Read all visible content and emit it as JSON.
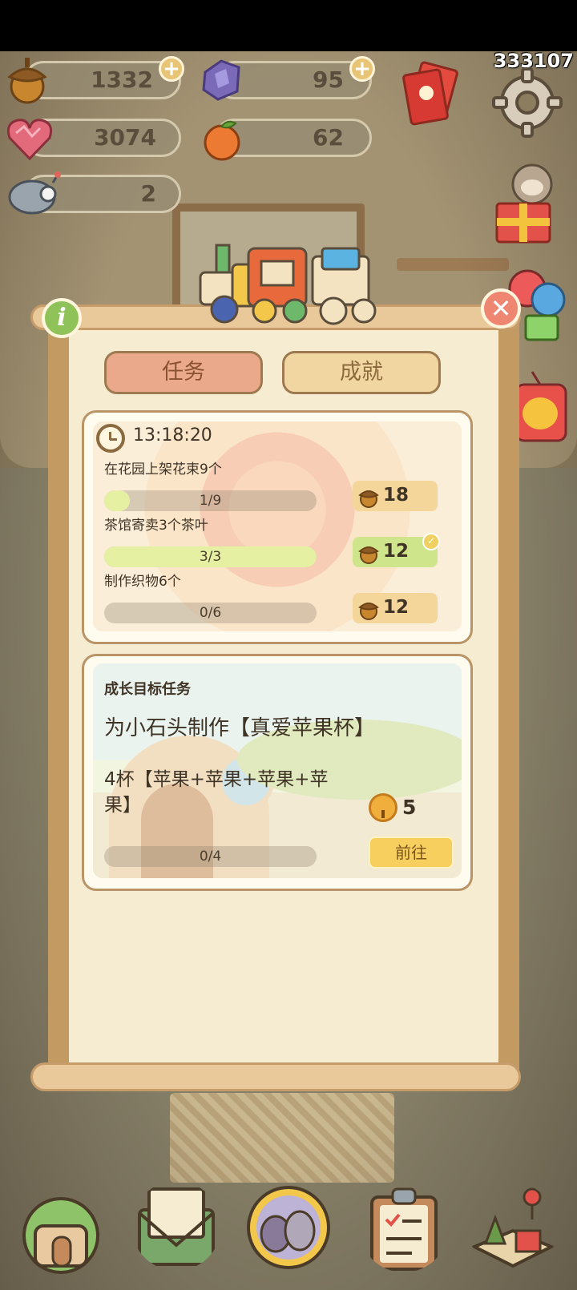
{
  "resources": {
    "acorns": "1332",
    "gems": "95",
    "hearts": "3074",
    "oranges": "62",
    "robot": "2"
  },
  "corner_counter": "333107",
  "panel": {
    "tabs": [
      {
        "label": "任务"
      },
      {
        "label": "成就"
      }
    ],
    "daily": {
      "timer": "13:18:20",
      "tasks": [
        {
          "title": "在花园上架花束9个",
          "progress_text": "1/9",
          "progress": 0.111,
          "reward": "18"
        },
        {
          "title": "茶馆寄卖3个茶叶",
          "progress_text": "3/3",
          "progress": 1.0,
          "reward": "12"
        },
        {
          "title": "制作织物6个",
          "progress_text": "0/6",
          "progress": 0.0,
          "reward": "12"
        }
      ]
    },
    "growth": {
      "label": "成长目标任务",
      "title": "为小石头制作【真爱苹果杯】",
      "desc": "4杯【苹果+苹果+苹果+苹果】",
      "reward": "5",
      "progress_text": "0/4",
      "progress": 0.0,
      "go_label": "前往"
    }
  },
  "icons": {
    "close": "✕",
    "info": "i",
    "check": "✓"
  }
}
